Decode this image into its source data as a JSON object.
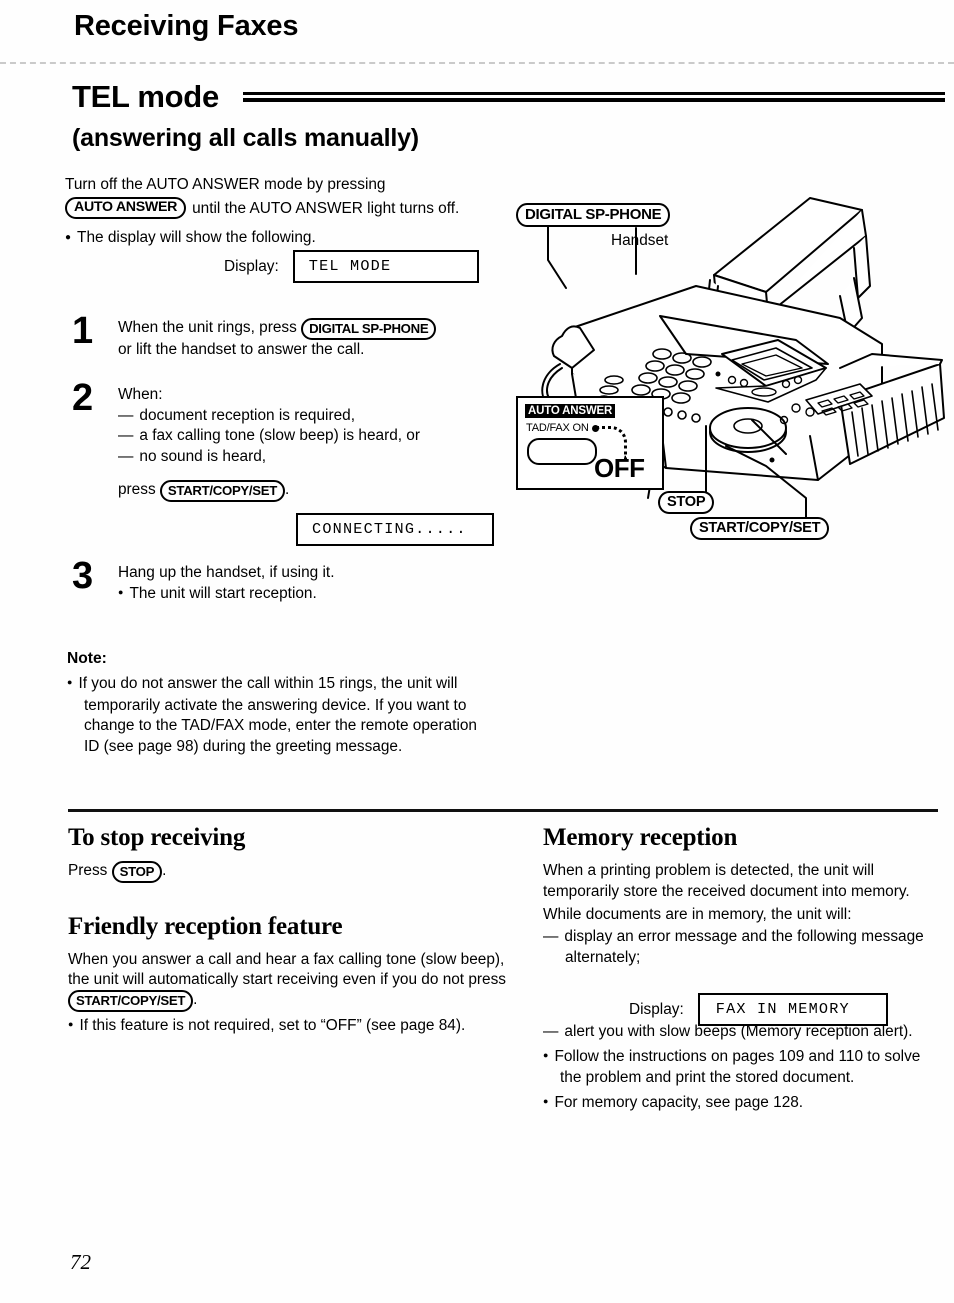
{
  "chapter_title": "Receiving Faxes",
  "mode_title": "TEL mode",
  "sub_title": "(answering all calls manually)",
  "intro": {
    "line1": "Turn off the AUTO ANSWER mode by pressing",
    "key_auto_answer": "AUTO ANSWER",
    "line2_rest": "until the AUTO ANSWER light turns off.",
    "bullet": "The display will show the following."
  },
  "displays": {
    "label": "Display:",
    "tel_mode": "TEL MODE",
    "connecting": "CONNECTING.....",
    "fax_in_memory": "FAX IN MEMORY"
  },
  "steps": [
    {
      "number": "1",
      "line1_pre": "When the unit rings, press",
      "key": "DIGITAL SP-PHONE",
      "line2": "or lift the handset to answer the call."
    },
    {
      "number": "2",
      "lead": "When:",
      "items": [
        "document reception is required,",
        "a fax calling tone (slow beep) is heard, or",
        "no sound is heard,"
      ],
      "press_pre": "press",
      "press_key": "START/COPY/SET",
      "press_post": "."
    },
    {
      "number": "3",
      "line1": "Hang up the handset, if using it.",
      "bullet": "The unit will start reception."
    }
  ],
  "note": {
    "heading": "Note:",
    "text": "If you do not answer the call within 15 rings, the unit will temporarily activate the answering device. If you want to change to the TAD/FAX mode, enter the remote operation ID (see page 98) during the greeting message."
  },
  "illustration": {
    "callout_sp_phone": "DIGITAL SP-PHONE",
    "label_handset": "Handset",
    "callout_stop": "STOP",
    "callout_start_copy_set": "START/COPY/SET",
    "detail": {
      "auto_answer": "AUTO ANSWER",
      "tad_fax_on": "TAD/FAX ON",
      "off": "OFF"
    }
  },
  "bottom_left": {
    "heading1": "To stop receiving",
    "press_pre": "Press",
    "press_key": "STOP",
    "press_post": ".",
    "heading2": "Friendly reception feature",
    "para_pre": "When you answer a call and hear a fax calling tone (slow beep), the unit will automatically start receiving even if you do not press",
    "para_key": "START/COPY/SET",
    "para_post": ".",
    "bullet": "If this feature is not required, set to “OFF” (see page 84)."
  },
  "bottom_right": {
    "heading": "Memory reception",
    "para1": "When a printing problem is detected, the unit will temporarily store the received document into memory.",
    "para2": "While documents are in memory, the unit will:",
    "dash1": "display an error message and the following message alternately;",
    "dash2": "alert you with slow beeps (Memory reception alert).",
    "bullet1": "Follow the instructions on pages 109 and 110 to solve the problem and print the stored document.",
    "bullet2": "For memory capacity, see page 128."
  },
  "folio": "72"
}
